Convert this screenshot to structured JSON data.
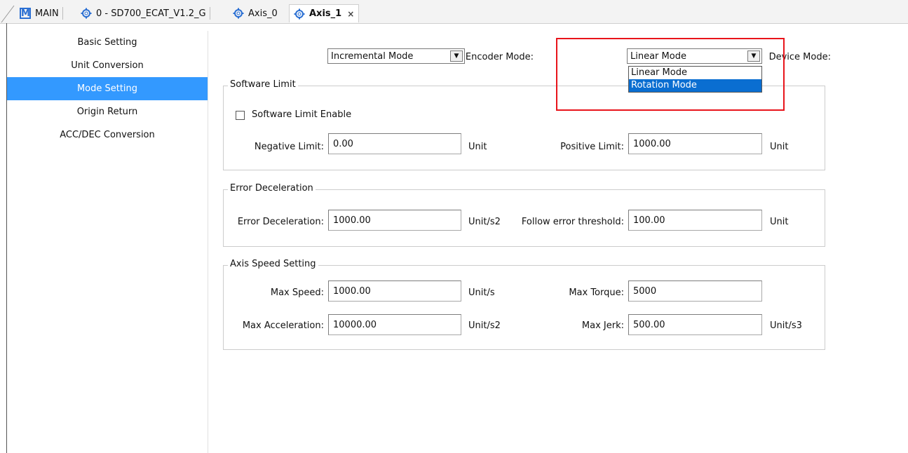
{
  "tabs": [
    {
      "label": "MAIN",
      "icon": "m-icon"
    },
    {
      "label": "0 - SD700_ECAT_V1.2_G",
      "icon": "gear-icon"
    },
    {
      "label": "Axis_0",
      "icon": "gear-icon"
    },
    {
      "label": "Axis_1",
      "icon": "gear-icon",
      "active": true,
      "close": "×"
    }
  ],
  "sidebar": {
    "items": [
      {
        "label": "Basic Setting"
      },
      {
        "label": "Unit Conversion"
      },
      {
        "label": "Mode Setting",
        "active": true
      },
      {
        "label": "Origin Return"
      },
      {
        "label": "ACC/DEC Conversion"
      }
    ]
  },
  "mode": {
    "encoder_label": "Encoder Mode:",
    "encoder_value": "Incremental Mode",
    "device_label": "Device Mode:",
    "device_value": "Linear Mode",
    "device_options": [
      "Linear Mode",
      "Rotation Mode"
    ],
    "device_highlighted": "Rotation Mode"
  },
  "software_limit": {
    "title": "Software Limit",
    "enable_label": "Software Limit Enable",
    "enable_checked": false,
    "negative_label": "Negative Limit:",
    "negative_value": "0.00",
    "negative_unit": "Unit",
    "positive_label": "Positive Limit:",
    "positive_value": "1000.00",
    "positive_unit": "Unit"
  },
  "error_decel": {
    "title": "Error Deceleration",
    "decel_label": "Error Deceleration:",
    "decel_value": "1000.00",
    "decel_unit": "Unit/s2",
    "threshold_label": "Follow error threshold:",
    "threshold_value": "100.00",
    "threshold_unit": "Unit"
  },
  "axis_speed": {
    "title": "Axis Speed Setting",
    "max_speed_label": "Max Speed:",
    "max_speed_value": "1000.00",
    "max_speed_unit": "Unit/s",
    "max_torque_label": "Max Torque:",
    "max_torque_value": "5000",
    "max_accel_label": "Max Acceleration:",
    "max_accel_value": "10000.00",
    "max_accel_unit": "Unit/s2",
    "max_jerk_label": "Max Jerk:",
    "max_jerk_value": "500.00",
    "max_jerk_unit": "Unit/s3"
  },
  "colors": {
    "accent": "#3399ff",
    "highlight": "#0a6ed1",
    "annotation": "#e8141b"
  }
}
